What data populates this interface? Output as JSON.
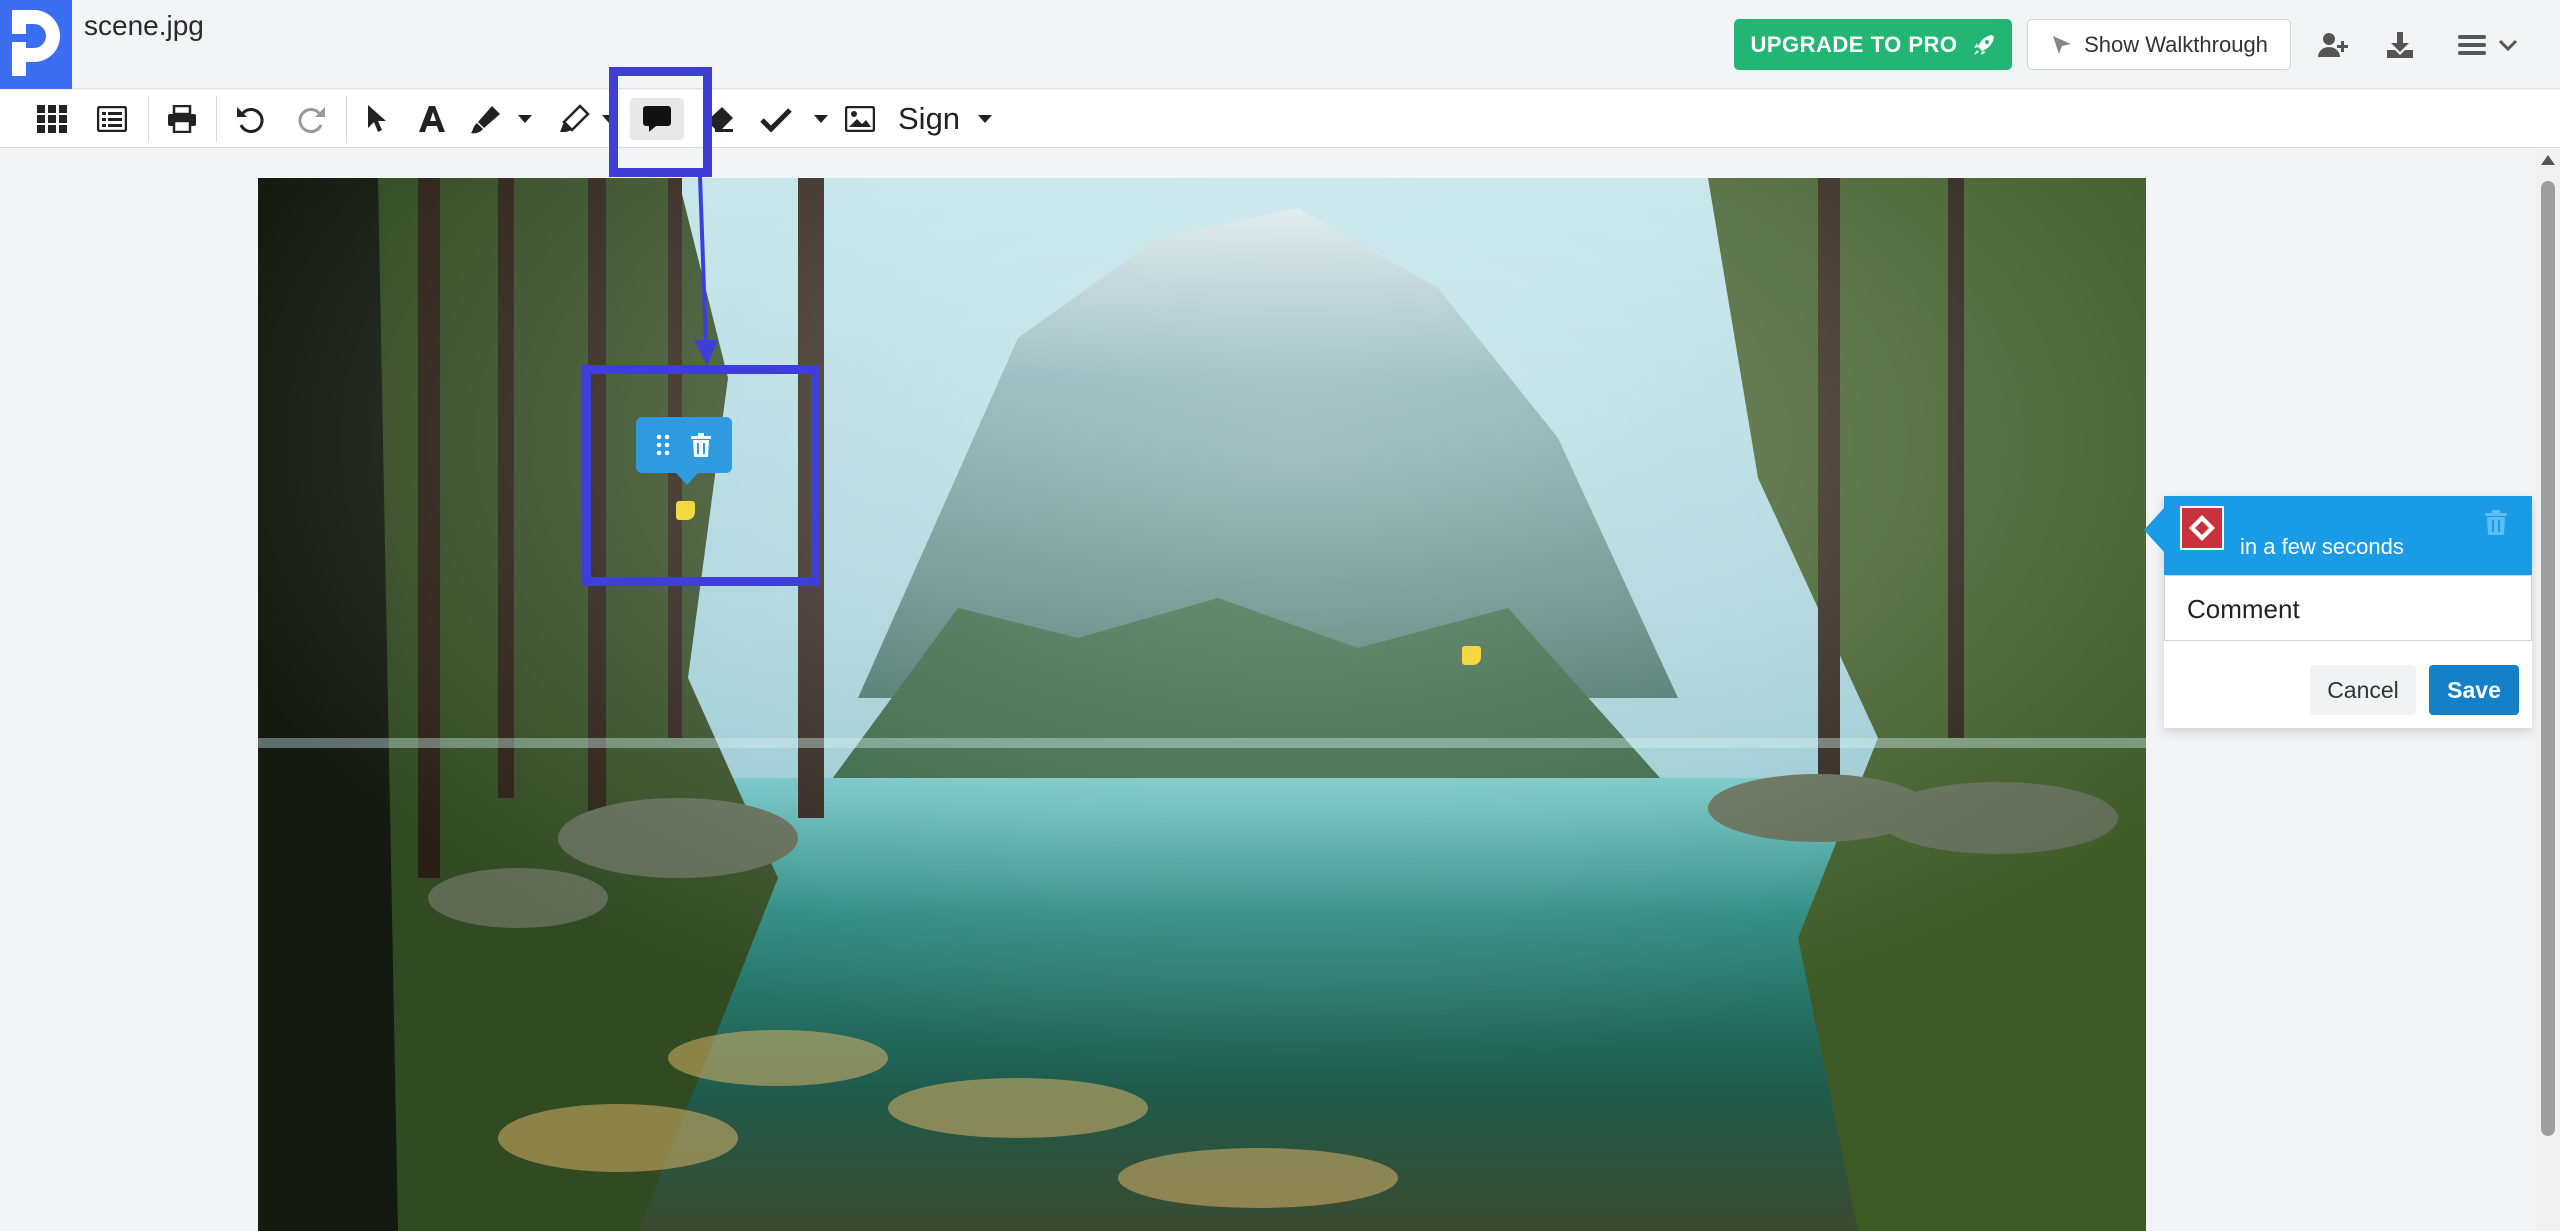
{
  "header": {
    "filename": "scene.jpg",
    "upgrade_label": "UPGRADE TO PRO",
    "walkthrough_label": "Show Walkthrough"
  },
  "toolbar": {
    "sign_label": "Sign"
  },
  "comment_popup": {
    "time_label": "in a few seconds",
    "comment_placeholder": "Comment",
    "cancel_label": "Cancel",
    "save_label": "Save"
  },
  "colors": {
    "brand_blue": "#3b6ef0",
    "upgrade_green": "#22b573",
    "highlight_box": "#3f3fd8",
    "popup_header": "#1a9be6",
    "save_button": "#1380c8",
    "comment_marker": "#f5d742"
  },
  "icons": [
    "grid-icon",
    "list-icon",
    "print-icon",
    "undo-icon",
    "redo-icon",
    "pointer-icon",
    "text-icon",
    "pen-icon",
    "highlighter-icon",
    "comment-icon",
    "eraser-icon",
    "checkmark-icon",
    "image-icon",
    "rocket-icon",
    "play-icon",
    "add-user-icon",
    "download-icon",
    "menu-icon",
    "drag-handle-icon",
    "trash-icon"
  ]
}
